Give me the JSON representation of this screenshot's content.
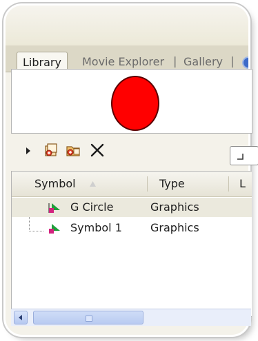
{
  "tabs": [
    {
      "label": "Library",
      "active": true
    },
    {
      "label": "Movie Explorer",
      "active": false
    },
    {
      "label": "Gallery",
      "active": false
    }
  ],
  "tab_separator": "|",
  "preview": {
    "shape": "circle",
    "fill_color": "#ff0000"
  },
  "toolbar": {
    "icons": [
      "expand-arrow-icon",
      "new-symbol-icon",
      "new-folder-icon",
      "delete-icon"
    ]
  },
  "list": {
    "columns": [
      "Symbol",
      "Type",
      "L"
    ],
    "rows": [
      {
        "name": "G Circle",
        "type": "Graphics",
        "selected": true
      },
      {
        "name": "Symbol 1",
        "type": "Graphics",
        "selected": false
      }
    ]
  },
  "colors": {
    "accent_red": "#ff0000",
    "selection": "#ebe9dd",
    "scrollbar": "#b9cbf1"
  }
}
